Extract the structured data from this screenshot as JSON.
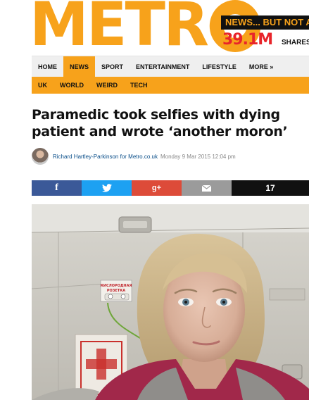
{
  "masthead": {
    "logo_text": "METRO",
    "logo_prefix": "METR",
    "promo_tag": "NEWS... BUT NOT AS YOU KNOW IT",
    "promo_count": "39.1M",
    "promo_shares": "SHARES"
  },
  "nav": {
    "items": [
      {
        "label": "HOME",
        "active": false
      },
      {
        "label": "NEWS",
        "active": true
      },
      {
        "label": "SPORT",
        "active": false
      },
      {
        "label": "ENTERTAINMENT",
        "active": false
      },
      {
        "label": "LIFESTYLE",
        "active": false
      },
      {
        "label": "MORE »",
        "active": false
      }
    ]
  },
  "subnav": {
    "items": [
      "UK",
      "WORLD",
      "WEIRD",
      "TECH"
    ]
  },
  "article": {
    "headline": "Paramedic took selfies with dying patient and wrote ‘another moron’",
    "byline_author": "Richard Hartley-Parkinson for Metro.co.uk",
    "byline_date": "Monday 9 Mar 2015 12:04 pm"
  },
  "share": {
    "facebook_label": "f",
    "google_label": "g+",
    "count": "17"
  },
  "photo": {
    "sign_text_line1": "КИСЛОРОДНАЯ",
    "sign_text_line2": "РОЗЕТКА"
  },
  "colors": {
    "brand_orange": "#f7a21b",
    "promo_red": "#e8242a",
    "facebook": "#3b5998",
    "twitter": "#1da1f2",
    "google": "#dd4b39",
    "email": "#9b9b9b"
  }
}
